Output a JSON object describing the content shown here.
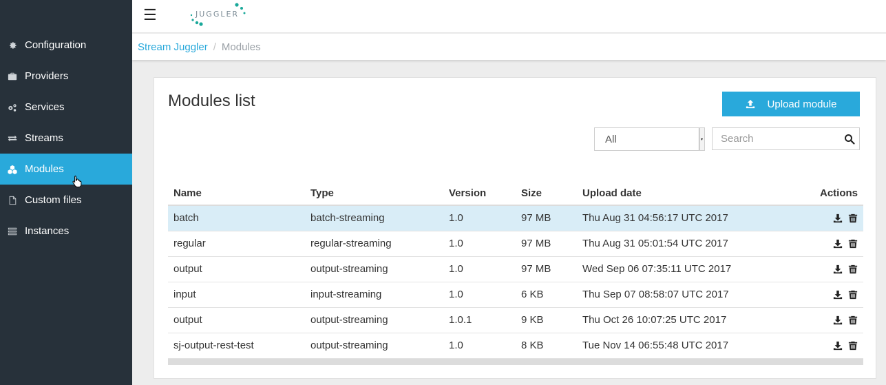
{
  "app": {
    "logo_text": "JUGGLER"
  },
  "sidebar": {
    "items": [
      {
        "label": "Configuration",
        "icon": "gear-icon"
      },
      {
        "label": "Providers",
        "icon": "briefcase-icon"
      },
      {
        "label": "Services",
        "icon": "gears-icon"
      },
      {
        "label": "Streams",
        "icon": "exchange-icon"
      },
      {
        "label": "Modules",
        "icon": "cubes-icon",
        "active": true
      },
      {
        "label": "Custom files",
        "icon": "file-icon"
      },
      {
        "label": "Instances",
        "icon": "list-icon"
      }
    ]
  },
  "breadcrumb": {
    "root": "Stream Juggler",
    "separator": "/",
    "current": "Modules"
  },
  "main": {
    "title": "Modules list",
    "upload_label": "Upload module",
    "filter": {
      "selected": "All"
    },
    "search": {
      "placeholder": "Search",
      "value": ""
    }
  },
  "table": {
    "headers": {
      "name": "Name",
      "type": "Type",
      "version": "Version",
      "size": "Size",
      "upload_date": "Upload date",
      "actions": "Actions"
    },
    "rows": [
      {
        "name": "batch",
        "type": "batch-streaming",
        "version": "1.0",
        "size": "97 MB",
        "upload_date": "Thu Aug 31 04:56:17 UTC 2017",
        "selected": true
      },
      {
        "name": "regular",
        "type": "regular-streaming",
        "version": "1.0",
        "size": "97 MB",
        "upload_date": "Thu Aug 31 05:01:54 UTC 2017"
      },
      {
        "name": "output",
        "type": "output-streaming",
        "version": "1.0",
        "size": "97 MB",
        "upload_date": "Wed Sep 06 07:35:11 UTC 2017"
      },
      {
        "name": "input",
        "type": "input-streaming",
        "version": "1.0",
        "size": "6 KB",
        "upload_date": "Thu Sep 07 08:58:07 UTC 2017"
      },
      {
        "name": "output",
        "type": "output-streaming",
        "version": "1.0.1",
        "size": "9 KB",
        "upload_date": "Thu Oct 26 10:07:25 UTC 2017"
      },
      {
        "name": "sj-output-rest-test",
        "type": "output-streaming",
        "version": "1.0",
        "size": "8 KB",
        "upload_date": "Tue Nov 14 06:55:48 UTC 2017"
      }
    ]
  },
  "colors": {
    "accent": "#29a9db",
    "sidebar_bg": "#27313a",
    "selected_row": "#d9edf7"
  }
}
